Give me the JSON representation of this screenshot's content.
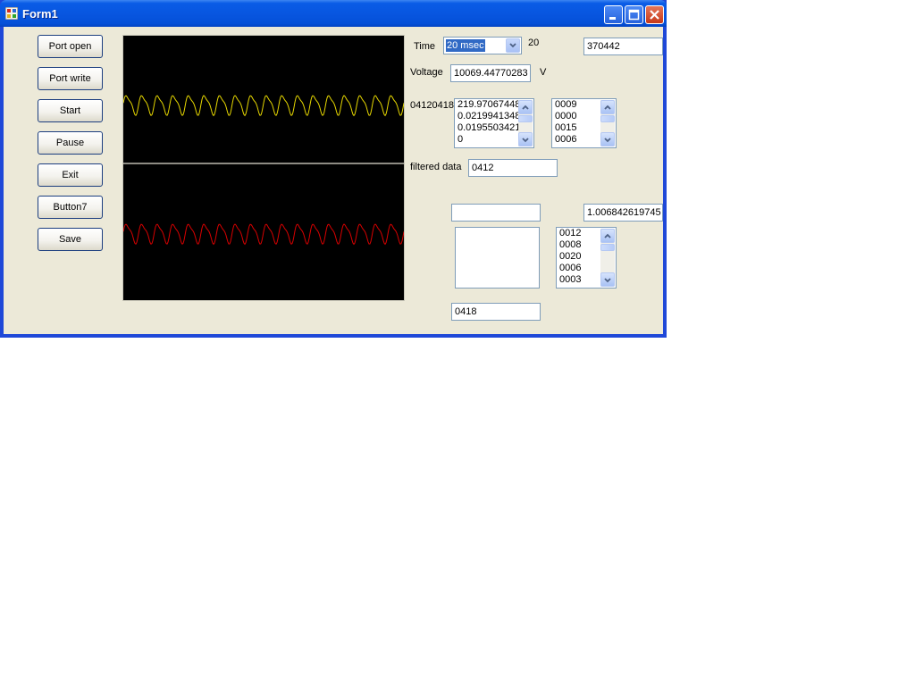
{
  "window": {
    "title": "Form1"
  },
  "buttons": {
    "port_open": "Port open",
    "port_write": "Port write",
    "start": "Start",
    "pause": "Pause",
    "exit": "Exit",
    "button7": "Button7",
    "save": "Save"
  },
  "time": {
    "label": "Time",
    "selected": "20 msec",
    "value_label": "20"
  },
  "counter_box": "370442",
  "voltage": {
    "label": "Voltage",
    "value": "10069.44770283",
    "unit": "V"
  },
  "raw_label": "04120418",
  "list_values": [
    "219.97067448",
    "0.0219941348",
    "0.0195503421",
    "0"
  ],
  "list_codes_1": [
    "0009",
    "0000",
    "0015",
    "0006"
  ],
  "filtered": {
    "label": "filtered data",
    "value": "0412"
  },
  "empty_box": "",
  "ratio_box": "1.006842619745",
  "list_codes_2": [
    "0012",
    "0008",
    "0020",
    "0006",
    "0003"
  ],
  "bottom_box": "0418",
  "colors": {
    "trace_top": "#e6d700",
    "trace_bottom": "#d80000",
    "selection": "#316ac5"
  },
  "icons": [
    "app-icon",
    "minimize-icon",
    "maximize-icon",
    "close-icon",
    "chevron-down-icon",
    "scroll-up-icon",
    "scroll-down-icon"
  ]
}
